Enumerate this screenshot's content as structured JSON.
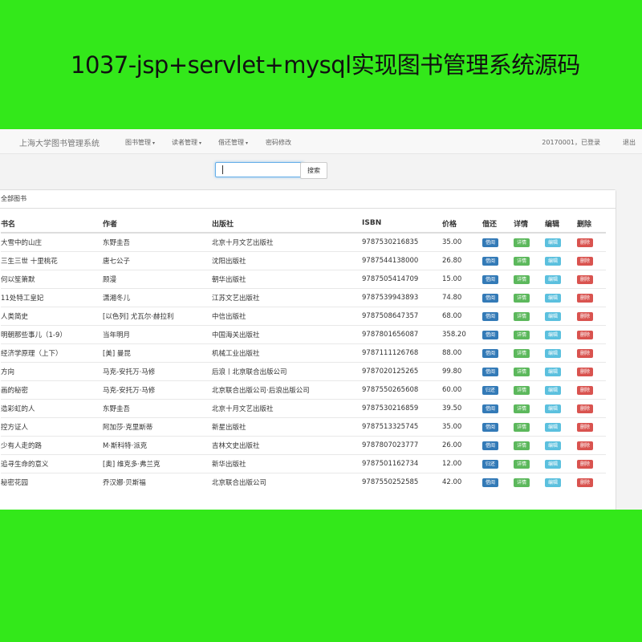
{
  "banner": {
    "title": "1037-jsp+servlet+mysql实现图书管理系统源码"
  },
  "navbar": {
    "brand": "上海大学图书管理系统",
    "menus": [
      "图书管理",
      "读者管理",
      "借还管理",
      "密码修改"
    ],
    "user": "20170001，已登录",
    "logout": "退出"
  },
  "search": {
    "placeholder": "",
    "button": "搜索"
  },
  "panel": {
    "title": "全部图书"
  },
  "table": {
    "headers": [
      "书名",
      "作者",
      "出版社",
      "ISBN",
      "价格",
      "借还",
      "详情",
      "编辑",
      "删除"
    ],
    "rows": [
      {
        "name": "大雪中的山庄",
        "author": "东野圭吾",
        "publisher": "北京十月文艺出版社",
        "isbn": "9787530216835",
        "price": "35.00",
        "action": "借阅"
      },
      {
        "name": "三生三世 十里桃花",
        "author": "唐七公子",
        "publisher": "沈阳出版社",
        "isbn": "9787544138000",
        "price": "26.80",
        "action": "借阅"
      },
      {
        "name": "何以笙箫默",
        "author": "顾漫",
        "publisher": "朝华出版社",
        "isbn": "9787505414709",
        "price": "15.00",
        "action": "借阅"
      },
      {
        "name": "11处特工皇妃",
        "author": "潇湘冬儿",
        "publisher": "江苏文艺出版社",
        "isbn": "9787539943893",
        "price": "74.80",
        "action": "借阅"
      },
      {
        "name": "人类简史",
        "author": "[以色列] 尤瓦尔·赫拉利",
        "publisher": "中信出版社",
        "isbn": "9787508647357",
        "price": "68.00",
        "action": "借阅"
      },
      {
        "name": "明朝那些事儿（1-9）",
        "author": "当年明月",
        "publisher": "中国海关出版社",
        "isbn": "9787801656087",
        "price": "358.20",
        "action": "借阅"
      },
      {
        "name": "经济学原理（上下）",
        "author": "[美] 曼昆",
        "publisher": "机械工业出版社",
        "isbn": "9787111126768",
        "price": "88.00",
        "action": "借阅"
      },
      {
        "name": "方向",
        "author": "马克-安托万·马修",
        "publisher": "后浪丨北京联合出版公司",
        "isbn": "9787020125265",
        "price": "99.80",
        "action": "借阅"
      },
      {
        "name": "画的秘密",
        "author": "马克-安托万·马修",
        "publisher": "北京联合出版公司·后浪出版公司",
        "isbn": "9787550265608",
        "price": "60.00",
        "action": "归还"
      },
      {
        "name": "造彩虹的人",
        "author": "东野圭吾",
        "publisher": "北京十月文艺出版社",
        "isbn": "9787530216859",
        "price": "39.50",
        "action": "借阅"
      },
      {
        "name": "控方证人",
        "author": "阿加莎·克里斯蒂",
        "publisher": "新星出版社",
        "isbn": "9787513325745",
        "price": "35.00",
        "action": "借阅"
      },
      {
        "name": "少有人走的路",
        "author": "M·斯科特·派克",
        "publisher": "吉林文史出版社",
        "isbn": "9787807023777",
        "price": "26.00",
        "action": "借阅"
      },
      {
        "name": "追寻生命的意义",
        "author": "[奥] 维克多·弗兰克",
        "publisher": "新华出版社",
        "isbn": "9787501162734",
        "price": "12.00",
        "action": "归还"
      },
      {
        "name": "秘密花园",
        "author": "乔汉娜·贝斯福",
        "publisher": "北京联合出版公司",
        "isbn": "9787550252585",
        "price": "42.00",
        "action": "借阅"
      }
    ],
    "detail_label": "详情",
    "edit_label": "编辑",
    "delete_label": "删除"
  },
  "colors": {
    "background": "#33e81a",
    "primary": "#337ab7",
    "success": "#5cb85c",
    "info": "#5bc0de",
    "danger": "#d9534f"
  }
}
